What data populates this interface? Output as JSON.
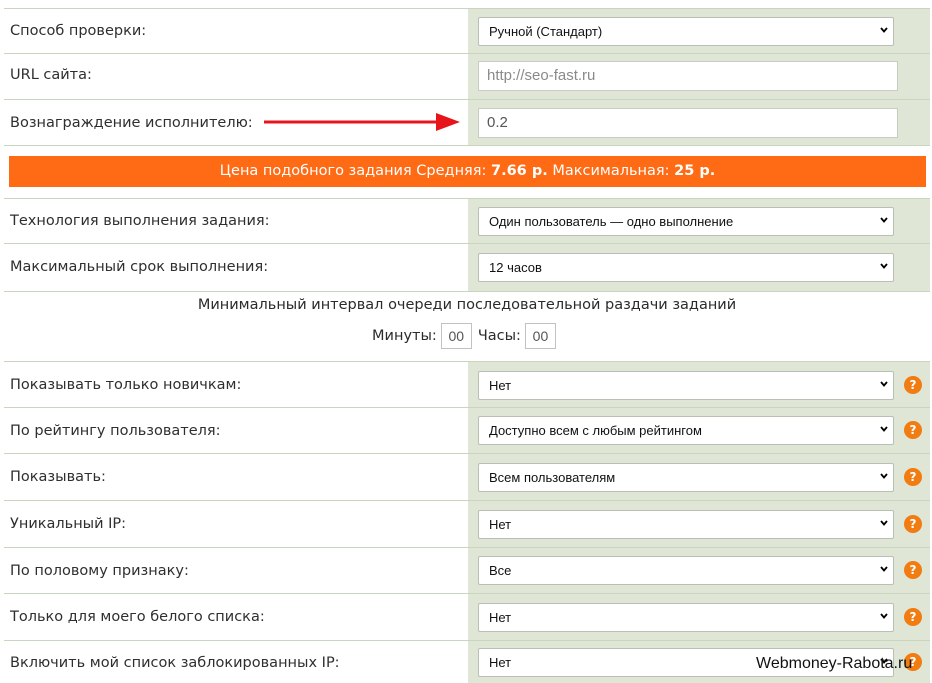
{
  "rows": {
    "check_method": {
      "label": "Способ проверки:",
      "value": "Ручной (Стандарт)"
    },
    "url": {
      "label": "URL сайта:",
      "placeholder": "http://seo-fast.ru"
    },
    "reward": {
      "label": "Вознаграждение исполнителю:",
      "value": "0.2"
    },
    "technology": {
      "label": "Технология выполнения задания:",
      "value": "Один пользователь — одно выполнение"
    },
    "deadline": {
      "label": "Максимальный срок выполнения:",
      "value": "12 часов"
    },
    "newcomers": {
      "label": "Показывать только новичкам:",
      "value": "Нет"
    },
    "rating": {
      "label": "По рейтингу пользователя:",
      "value": "Доступно всем с любым рейтингом"
    },
    "show": {
      "label": "Показывать:",
      "value": "Всем пользователям"
    },
    "unique_ip": {
      "label": "Уникальный IP:",
      "value": "Нет"
    },
    "gender": {
      "label": "По половому признаку:",
      "value": "Все"
    },
    "whitelist": {
      "label": "Только для моего белого списка:",
      "value": "Нет"
    },
    "blocklist": {
      "label": "Включить мой список заблокированных IP:",
      "value": "Нет"
    }
  },
  "price_banner": {
    "prefix": "Цена подобного задания Средняя: ",
    "avg": "7.66 р.",
    "mid": " Максимальная: ",
    "max": "25 р."
  },
  "interval": {
    "title": "Минимальный интервал очереди последовательной раздачи заданий",
    "minutes_label": "Минуты:",
    "minutes_value": "00",
    "hours_label": "Часы:",
    "hours_value": "00"
  },
  "help_glyph": "?",
  "watermark": "Webmoney-Rabota.ru",
  "colors": {
    "accent": "#ff6a14",
    "cell_bg": "#dfe6d6",
    "arrow": "#e8141b",
    "help": "#f07c12"
  }
}
